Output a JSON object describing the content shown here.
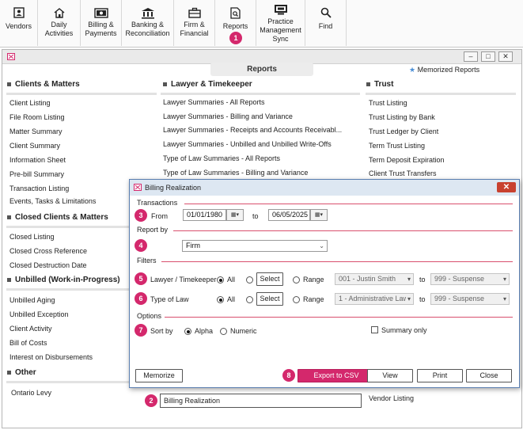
{
  "toolbar": {
    "items": [
      {
        "label": "Vendors",
        "icon": "person-badge-icon"
      },
      {
        "label": "Daily\nActivities",
        "icon": "home-icon"
      },
      {
        "label": "Billing &\nPayments",
        "icon": "money-icon"
      },
      {
        "label": "Banking &\nReconciliation",
        "icon": "bank-icon"
      },
      {
        "label": "Firm &\nFinancial",
        "icon": "briefcase-icon"
      },
      {
        "label": "Reports",
        "icon": "report-search-icon"
      },
      {
        "label": "Practice\nManagement\nSync",
        "icon": "sync-icon"
      },
      {
        "label": "Find",
        "icon": "search-icon"
      }
    ]
  },
  "badges": {
    "b1": "1",
    "b2": "2",
    "b3": "3",
    "b4": "4",
    "b5": "5",
    "b6": "6",
    "b7": "7",
    "b8": "8"
  },
  "window": {
    "controls": {
      "minimize": "–",
      "restore": "□",
      "close": "✕"
    },
    "tab_title": "Reports",
    "memorized": "Memorized Reports",
    "columns": {
      "clients": {
        "heading": "Clients & Matters",
        "items": [
          "Client Listing",
          "File Room Listing",
          "Matter Summary",
          "Client Summary",
          "Information Sheet",
          "Pre-bill Summary",
          "Transaction Listing",
          "Events, Tasks & Limitations"
        ]
      },
      "closed": {
        "heading": "Closed Clients & Matters",
        "items": [
          "Closed Listing",
          "Closed Cross Reference",
          "Closed Destruction Date"
        ]
      },
      "unbilled": {
        "heading": "Unbilled (Work-in-Progress)",
        "items": [
          "Unbilled Aging",
          "Unbilled Exception",
          "Client Activity",
          "Bill of Costs",
          "Interest on Disbursements"
        ]
      },
      "other": {
        "heading": "Other",
        "items": [
          "Ontario Levy"
        ]
      },
      "lawyer": {
        "heading": "Lawyer & Timekeeper",
        "items": [
          "Lawyer Summaries - All Reports",
          "Lawyer Summaries - Billing and Variance",
          "Lawyer Summaries - Receipts and Accounts Receivabl...",
          "Lawyer Summaries - Unbilled and Unbilled Write-Offs",
          "Type of Law Summaries - All Reports",
          "Type of Law Summaries - Billing and Variance"
        ]
      },
      "trust": {
        "heading": "Trust",
        "items": [
          "Trust Listing",
          "Trust Listing by Bank",
          "Trust Ledger by Client",
          "Term Trust Listing",
          "Term Deposit Expiration",
          "Client Trust Transfers"
        ]
      }
    },
    "selected_report": "Billing Realization",
    "vendor_listing": "Vendor Listing"
  },
  "dialog": {
    "title": "Billing Realization",
    "close": "✕",
    "transactions": {
      "label": "Transactions",
      "from_label": "From",
      "from_value": "01/01/1980",
      "to_label": "to",
      "to_value": "06/05/2025"
    },
    "report_by": {
      "label": "Report by",
      "value": "Firm"
    },
    "filters": {
      "label": "Filters",
      "lawyer": {
        "label": "Lawyer / Timekeeper",
        "all": "All",
        "select": "Select",
        "range": "Range",
        "from": "001 - Justin Smith",
        "to_label": "to",
        "to": "999 - Suspense"
      },
      "type_of_law": {
        "label": "Type of Law",
        "all": "All",
        "select": "Select",
        "range": "Range",
        "from": "1 - Administrative Law",
        "to_label": "to",
        "to": "999 - Suspense"
      }
    },
    "options": {
      "label": "Options",
      "sort_by": "Sort by",
      "alpha": "Alpha",
      "numeric": "Numeric",
      "summary_only": "Summary only"
    },
    "buttons": {
      "memorize": "Memorize",
      "export": "Export to CSV",
      "view": "View",
      "print": "Print",
      "close": "Close"
    }
  },
  "colors": {
    "accent": "#d4286c",
    "dialog_border": "#5a7eb0",
    "title_bar": "#dde7f2"
  }
}
